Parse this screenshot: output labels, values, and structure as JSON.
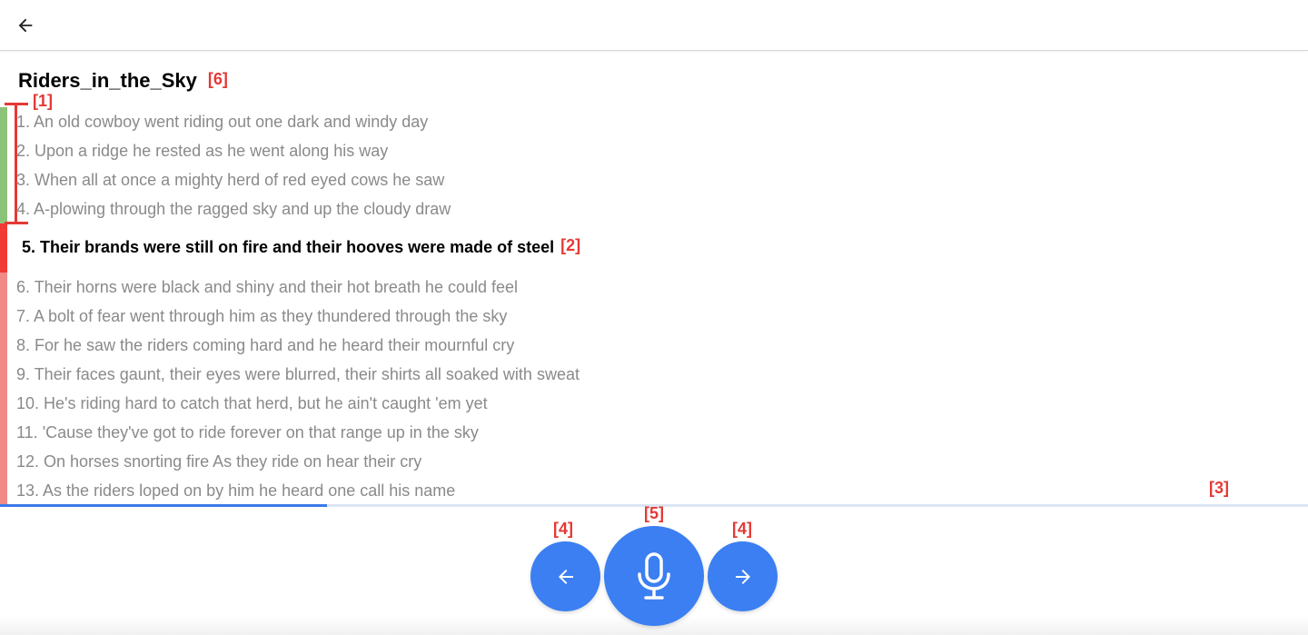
{
  "header": {
    "back_icon": "arrow-left-icon"
  },
  "song": {
    "title": "Riders_in_the_Sky",
    "title_annotation": "[6]"
  },
  "annotations": {
    "completed_range": "[1]",
    "current_line": "[2]",
    "scrollbar": "[3]",
    "nav_prev": "[4]",
    "mic": "[5]",
    "nav_next": "[4]"
  },
  "lyrics": {
    "lines": [
      "1. An old cowboy went riding out one dark and windy day",
      "2. Upon a ridge he rested as he went along his way",
      "3. When all at once a mighty herd of red eyed cows he saw",
      "4. A-plowing through the ragged sky and up the cloudy draw",
      "5. Their brands were still on fire and their hooves were made of steel",
      "6. Their horns were black and shiny and their hot breath he could feel",
      "7. A bolt of fear went through him as they thundered through the sky",
      "8. For he saw the riders coming hard and he heard their mournful cry",
      "9. Their faces gaunt, their eyes were blurred, their shirts all soaked with sweat",
      "10. He's riding hard to catch that herd, but he ain't caught 'em yet",
      "11. 'Cause they've got to ride forever on that range up in the sky",
      "12. On horses snorting fire As they ride on hear their cry",
      "13. As the riders loped on by him he heard one call his name"
    ],
    "current_index": 4
  },
  "controls": {
    "prev_icon": "arrow-left-icon",
    "mic_icon": "microphone-icon",
    "next_icon": "arrow-right-icon"
  },
  "colors": {
    "accent": "#3b7ff2",
    "completed": "#8dc27a",
    "current": "#f03a33",
    "pending": "#f08a86",
    "annotation": "#e53935"
  }
}
